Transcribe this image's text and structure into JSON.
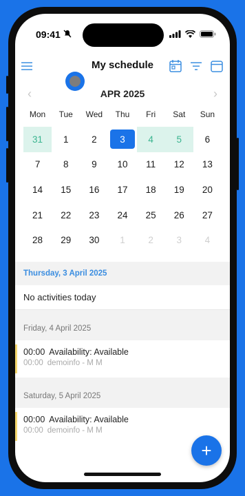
{
  "status": {
    "time": "09:41"
  },
  "header": {
    "title": "My schedule"
  },
  "calendar": {
    "month": "APR 2025",
    "prev": "‹",
    "next": "›",
    "weekdays": [
      "Mon",
      "Tue",
      "Wed",
      "Thu",
      "Fri",
      "Sat",
      "Sun"
    ],
    "weeks": [
      [
        "31",
        "1",
        "2",
        "3",
        "4",
        "5",
        "6"
      ],
      [
        "7",
        "8",
        "9",
        "10",
        "11",
        "12",
        "13"
      ],
      [
        "14",
        "15",
        "16",
        "17",
        "18",
        "19",
        "20"
      ],
      [
        "21",
        "22",
        "23",
        "24",
        "25",
        "26",
        "27"
      ],
      [
        "28",
        "29",
        "30",
        "1",
        "2",
        "3",
        "4"
      ]
    ],
    "selected_day": "3"
  },
  "sections": [
    {
      "heading": "Thursday, 3 April 2025",
      "empty_text": "No activities today"
    },
    {
      "heading": "Friday, 4 April 2025",
      "event": {
        "start": "00:00",
        "end": "00:00",
        "title": "Availability: Available",
        "owner": "demoinfo - M M"
      }
    },
    {
      "heading": "Saturday, 5 April 2025",
      "event": {
        "start": "00:00",
        "end": "00:00",
        "title": "Availability: Available",
        "owner": "demoinfo - M M"
      }
    }
  ],
  "fab": {
    "label": "+"
  },
  "colors": {
    "accent": "#1a73e8",
    "today_highlight": "#dcf3ec",
    "today_text": "#3ab48f"
  }
}
